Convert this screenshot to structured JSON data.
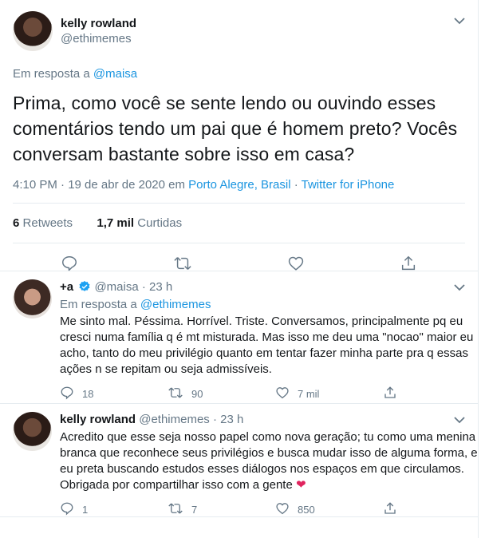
{
  "main_tweet": {
    "display_name": "kelly rowland",
    "handle": "@ethimemes",
    "reply_prefix": "Em resposta a",
    "reply_to": "@maisa",
    "text": "Prima, como você se sente lendo ou ouvindo esses comentários tendo um pai que é homem preto? Vocês conversam bastante sobre isso em casa?",
    "time_date": "4:10 PM · 19 de abr de 2020 em",
    "location": "Porto Alegre, Brasil",
    "sep": "·",
    "source": "Twitter for iPhone",
    "retweets_count": "6",
    "retweets_label": "Retweets",
    "likes_count": "1,7 mil",
    "likes_label": "Curtidas",
    "icons": [
      "reply-icon",
      "retweet-icon",
      "like-icon",
      "share-icon"
    ]
  },
  "replies": [
    {
      "display_name": "+a",
      "verified": true,
      "handle": "@maisa",
      "time": "· 23 h",
      "reply_prefix": "Em resposta a",
      "reply_to": "@ethimemes",
      "text": "Me sinto mal. Péssima. Horrível. Triste. Conversamos, principalmente pq eu cresci numa família q é mt misturada. Mas isso me deu uma \"nocao\" maior eu acho, tanto do meu privilégio quanto em tentar fazer minha parte pra q essas ações n se repitam ou seja admissíveis.",
      "reply_count": "18",
      "retweet_count": "90",
      "like_count": "7 mil"
    },
    {
      "display_name": "kelly rowland",
      "handle": "@ethimemes",
      "time": "· 23 h",
      "text": "Acredito que esse seja nosso papel como nova geração; tu como uma menina branca que reconhece seus privilégios e busca mudar isso de alguma forma, e eu preta buscando estudos esses diálogos nos espaços em que circulamos. Obrigada por compartilhar isso com a gente",
      "emoji": "❤",
      "reply_count": "1",
      "retweet_count": "7",
      "like_count": "850"
    }
  ],
  "colors": {
    "link": "#1b95e0",
    "muted": "#657786",
    "text": "#14171a",
    "heart": "#e0245e",
    "verified": "#1da1f2"
  }
}
